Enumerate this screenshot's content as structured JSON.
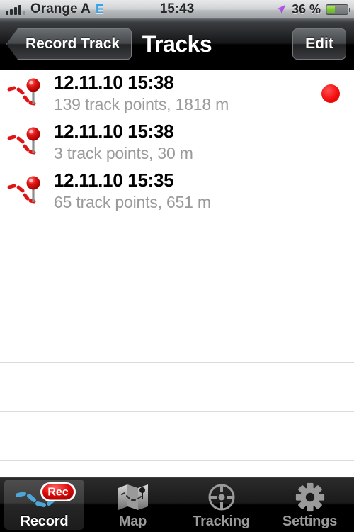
{
  "status_bar": {
    "signal_icon": "signal-bars-icon",
    "carrier": "Orange A",
    "network_type": "E",
    "time": "15:43",
    "location_icon": "location-arrow-icon",
    "battery_percent": "36 %",
    "battery_level": 36,
    "battery_icon": "battery-icon"
  },
  "nav_bar": {
    "back_label": "Record Track",
    "title": "Tracks",
    "edit_label": "Edit"
  },
  "tracks": [
    {
      "icon": "track-pin-icon",
      "title": "12.11.10 15:38",
      "subtitle": "139 track points, 1818 m",
      "recording": true,
      "accessory_icon": "recording-dot-icon"
    },
    {
      "icon": "track-pin-icon",
      "title": "12.11.10 15:38",
      "subtitle": "3 track points, 30 m",
      "recording": false,
      "accessory_icon": ""
    },
    {
      "icon": "track-pin-icon",
      "title": "12.11.10 15:35",
      "subtitle": "65 track points, 651 m",
      "recording": false,
      "accessory_icon": ""
    }
  ],
  "empty_row_count": 5,
  "tab_bar": {
    "tabs": [
      {
        "label": "Record",
        "icon": "record-track-icon",
        "badge": "Rec",
        "active": true
      },
      {
        "label": "Map",
        "icon": "map-icon",
        "badge": "",
        "active": false
      },
      {
        "label": "Tracking",
        "icon": "crosshair-icon",
        "badge": "",
        "active": false
      },
      {
        "label": "Settings",
        "icon": "gear-icon",
        "badge": "",
        "active": false
      }
    ]
  },
  "colors": {
    "accent_red": "#e00b0b",
    "track_blue": "#4da6d8",
    "subtitle_gray": "#9a9a9a",
    "separator": "#dcdcdc"
  }
}
